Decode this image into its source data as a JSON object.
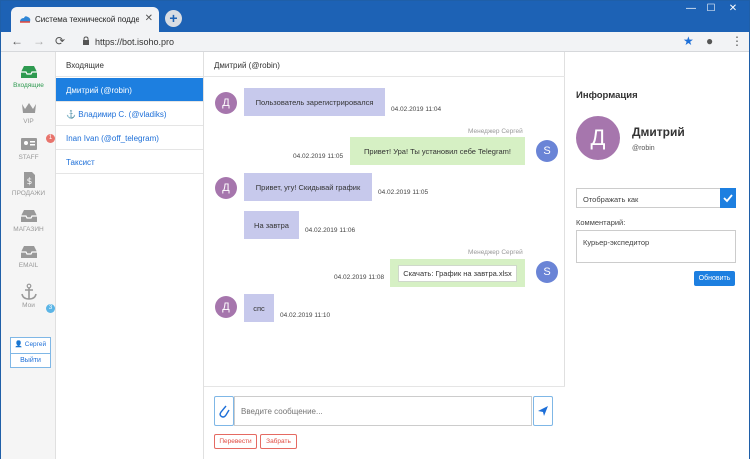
{
  "browser": {
    "tab_title": "Система технической поддержки",
    "new_tab": "+",
    "url": "https://bot.isoho.pro"
  },
  "leftnav": {
    "items": [
      {
        "label": "Входящие",
        "icon": "inbox-icon"
      },
      {
        "label": "VIP",
        "icon": "crown-icon"
      },
      {
        "label": "STAFF",
        "icon": "id-card-icon",
        "badge": "1"
      },
      {
        "label": "ПРОДАЖИ",
        "icon": "dollar-document-icon"
      },
      {
        "label": "МАГАЗИН",
        "icon": "inbox-tray-icon"
      },
      {
        "label": "EMAIL",
        "icon": "email-tray-icon"
      },
      {
        "label": "Мои",
        "icon": "anchor-icon",
        "badge": "3"
      }
    ],
    "user": {
      "name": "Сергей",
      "logout": "Выйти"
    }
  },
  "chatlist": {
    "header": "Входящие",
    "items": [
      {
        "label": "Дмитрий (@robin)"
      },
      {
        "label": "Владимир С. (@vladiks)"
      },
      {
        "label": "Inan Ivan (@off_telegram)"
      },
      {
        "label": "Таксист"
      }
    ]
  },
  "chat": {
    "header": "Дмитрий (@robin)",
    "messages": [
      {
        "avatar": "Д",
        "text": "Пользователь зарегистрировался",
        "time": "04.02.2019 11:04"
      },
      {
        "sender": "Менеджер Сергей",
        "avatar": "S",
        "text": "Привет! Ура! Ты установил себе Telegram!",
        "time": "04.02.2019 11:05"
      },
      {
        "avatar": "Д",
        "text": "Привет, угу! Скидывай график",
        "time": "04.02.2019 11:05"
      },
      {
        "text": "На завтра",
        "time": "04.02.2019 11:06"
      },
      {
        "sender": "Менеджер Сергей",
        "avatar": "S",
        "text": "Скачать: График на завтра.xlsx",
        "time": "04.02.2019 11:08"
      },
      {
        "avatar": "Д",
        "text": "спс",
        "time": "04.02.2019 11:10"
      }
    ],
    "composer": {
      "placeholder": "Введите сообщение...",
      "transfer": "Перевести",
      "take": "Забрать"
    }
  },
  "info": {
    "title": "Информация",
    "avatar": "Д",
    "name": "Дмитрий",
    "handle": "@robin",
    "display_select": "Отображать как",
    "comment_label": "Комментарий:",
    "comment": "Курьер-экспедитор",
    "update": "Обновить"
  },
  "colors": {
    "accent": "#1d7fe0",
    "titlebar": "#1d62b5",
    "incoming_bubble": "#c7c9ec",
    "outgoing_bubble": "#d6f0c4",
    "client_avatar": "#a676ad",
    "manager_avatar": "#6a84d6"
  }
}
